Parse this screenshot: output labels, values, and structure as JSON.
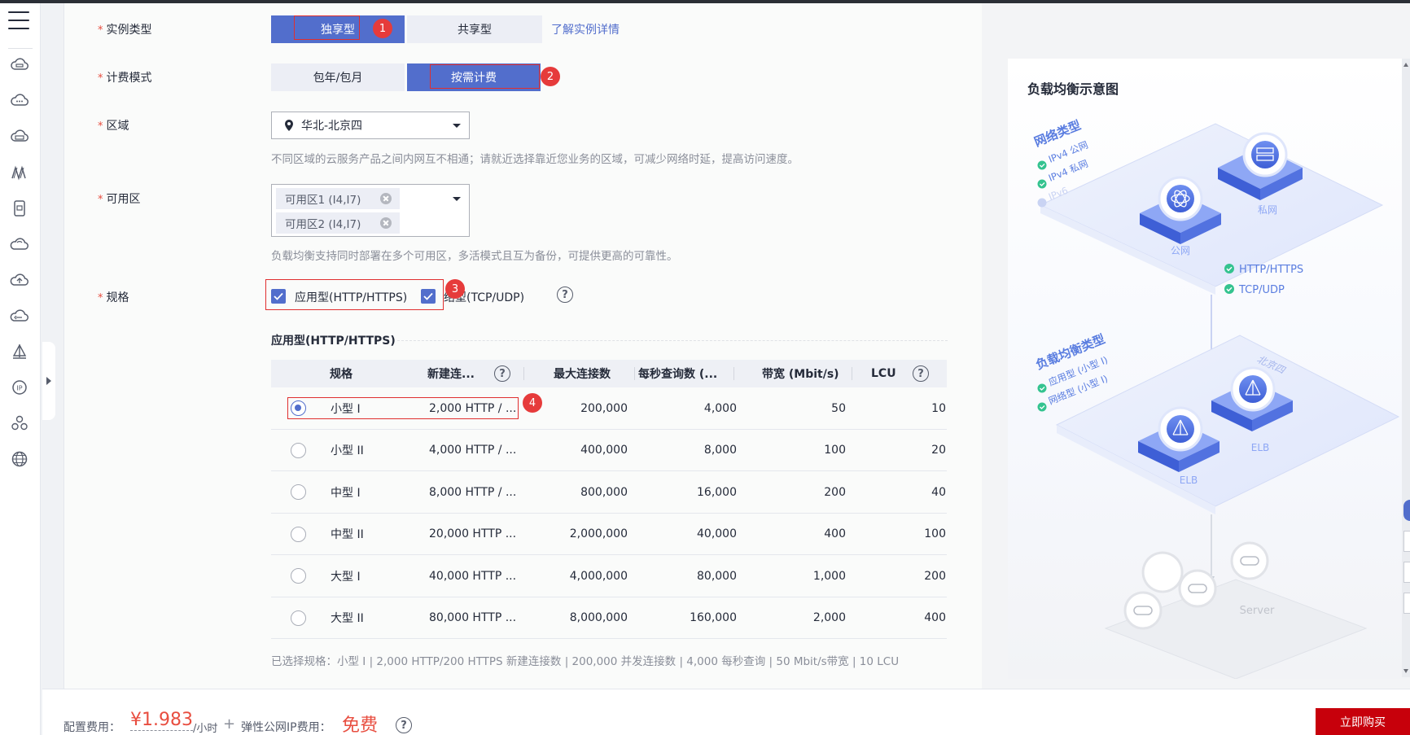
{
  "sidebar": {
    "icons": [
      "menu-icon",
      "cloud-server-icon",
      "cloud-icon",
      "storage-icon",
      "network-icon",
      "database-icon",
      "cloud-outline-icon",
      "cloud-upload-icon",
      "cloud-swap-icon",
      "ship-icon",
      "ip-icon",
      "cluster-icon",
      "globe-icon"
    ]
  },
  "form": {
    "instance_type": {
      "label": "实例类型",
      "options": [
        "独享型",
        "共享型"
      ],
      "selected": "独享型",
      "detail_link": "了解实例详情"
    },
    "billing": {
      "label": "计费模式",
      "options": [
        "包年/包月",
        "按需计费"
      ],
      "selected": "按需计费"
    },
    "region": {
      "label": "区域",
      "value": "华北-北京四",
      "hint": "不同区域的云服务产品之间内网互不相通；请就近选择靠近您业务的区域，可减少网络时延，提高访问速度。"
    },
    "az": {
      "label": "可用区",
      "chips": [
        "可用区1 (I4,I7)",
        "可用区2 (I4,I7)"
      ],
      "hint": "负载均衡支持同时部署在多个可用区，多活模式且互为备份，可提供更高的可靠性。"
    },
    "spec": {
      "label": "规格",
      "options": [
        "应用型(HTTP/HTTPS)",
        "网络型(TCP/UDP)"
      ],
      "option2_visible": "络型(TCP/UDP)",
      "help": "?"
    },
    "required_mark": "*"
  },
  "annotations": [
    "1",
    "2",
    "3",
    "4"
  ],
  "spec_table": {
    "section_title": "应用型(HTTP/HTTPS)",
    "columns": [
      "规格",
      "新建连...",
      "最大连接数",
      "每秒查询数 (...",
      "带宽 (Mbit/s)",
      "LCU"
    ],
    "help": "?",
    "rows": [
      {
        "name": "小型 I",
        "new_conn": "2,000 HTTP / ...",
        "max_conn": "200,000",
        "qps": "4,000",
        "bw": "50",
        "lcu": "10",
        "selected": true
      },
      {
        "name": "小型 II",
        "new_conn": "4,000 HTTP / ...",
        "max_conn": "400,000",
        "qps": "8,000",
        "bw": "100",
        "lcu": "20",
        "selected": false
      },
      {
        "name": "中型 I",
        "new_conn": "8,000 HTTP / ...",
        "max_conn": "800,000",
        "qps": "16,000",
        "bw": "200",
        "lcu": "40",
        "selected": false
      },
      {
        "name": "中型 II",
        "new_conn": "20,000 HTTP ...",
        "max_conn": "2,000,000",
        "qps": "40,000",
        "bw": "400",
        "lcu": "100",
        "selected": false
      },
      {
        "name": "大型 I",
        "new_conn": "40,000 HTTP ...",
        "max_conn": "4,000,000",
        "qps": "80,000",
        "bw": "1,000",
        "lcu": "200",
        "selected": false
      },
      {
        "name": "大型 II",
        "new_conn": "80,000 HTTP ...",
        "max_conn": "8,000,000",
        "qps": "160,000",
        "bw": "2,000",
        "lcu": "400",
        "selected": false
      }
    ],
    "summary": "已选择规格：小型 I | 2,000 HTTP/200 HTTPS 新建连接数 | 200,000 并发连接数 | 4,000 每秒查询 | 50 Mbit/s带宽 | 10 LCU"
  },
  "diagram": {
    "title": "负载均衡示意图",
    "network_type_title": "网络类型",
    "network_types": [
      "IPv4 公网",
      "IPv4 私网",
      "IPv6"
    ],
    "public_label": "公网",
    "private_label": "私网",
    "protocols": [
      "HTTP/HTTPS",
      "TCP/UDP"
    ],
    "lb_type_title": "负载均衡类型",
    "lb_types": [
      "应用型 (小型 I)",
      "网络型 (小型 I)"
    ],
    "region_label": "北京四",
    "elb_label": "ELB",
    "server_label": "Server",
    "colors": {
      "accent": "#526ecc",
      "check": "#34c38f"
    }
  },
  "footer": {
    "config_fee_label": "配置费用：",
    "price": "¥1.983",
    "price_unit": "/小时",
    "plus": "+",
    "eip_fee_label": "弹性公网IP费用：",
    "eip_fee": "免费",
    "help": "?",
    "buy_label": "立即购买"
  }
}
